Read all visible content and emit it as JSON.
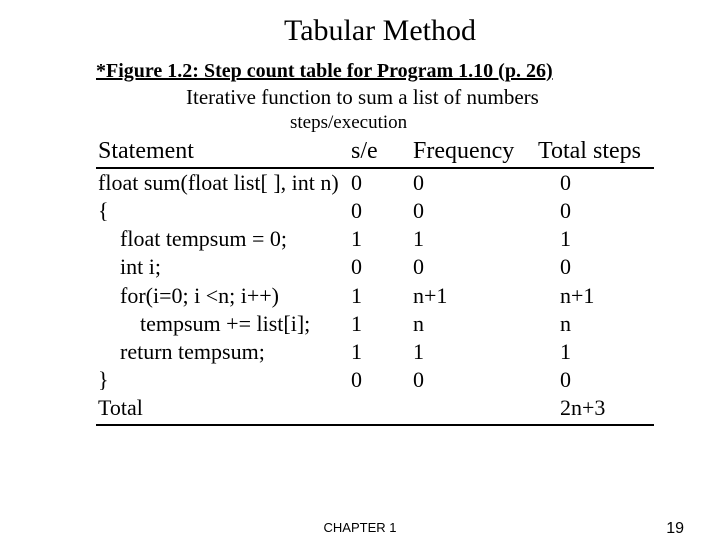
{
  "title": "Tabular Method",
  "figref": "*Figure 1.2: Step count table for Program 1.10 (p. 26)",
  "subtitle": "Iterative function to sum a list of numbers",
  "steps_execution": "steps/execution",
  "headers": {
    "statement": "Statement",
    "se": "s/e",
    "frequency": "Frequency",
    "total": "Total steps"
  },
  "rows": [
    {
      "stmt": "float sum(float list[ ], int n)",
      "indent": 0,
      "se": "0",
      "freq": "0",
      "tot": "0"
    },
    {
      "stmt": "{",
      "indent": 0,
      "se": "0",
      "freq": "0",
      "tot": "0"
    },
    {
      "stmt": "float tempsum = 0;",
      "indent": 1,
      "se": "1",
      "freq": "1",
      "tot": "1"
    },
    {
      "stmt": "int i;",
      "indent": 1,
      "se": "0",
      "freq": "0",
      "tot": "0"
    },
    {
      "stmt": "for(i=0; i <n; i++)",
      "indent": 1,
      "se": "1",
      "freq": "n+1",
      "tot": "n+1"
    },
    {
      "stmt": "tempsum += list[i];",
      "indent": 2,
      "se": "1",
      "freq": "n",
      "tot": "n"
    },
    {
      "stmt": "return tempsum;",
      "indent": 1,
      "se": "1",
      "freq": "1",
      "tot": "1"
    },
    {
      "stmt": "}",
      "indent": 0,
      "se": "0",
      "freq": "0",
      "tot": "0"
    },
    {
      "stmt": "Total",
      "indent": 0,
      "se": "",
      "freq": "",
      "tot": "2n+3"
    }
  ],
  "footer": {
    "chapter": "CHAPTER 1",
    "page": "19"
  },
  "chart_data": {
    "type": "table",
    "title": "Step count table for Program 1.10",
    "columns": [
      "Statement",
      "s/e",
      "Frequency",
      "Total steps"
    ],
    "rows": [
      [
        "float sum(float list[ ], int n)",
        "0",
        "0",
        "0"
      ],
      [
        "{",
        "0",
        "0",
        "0"
      ],
      [
        "float tempsum = 0;",
        "1",
        "1",
        "1"
      ],
      [
        "int i;",
        "0",
        "0",
        "0"
      ],
      [
        "for(i=0; i <n; i++)",
        "1",
        "n+1",
        "n+1"
      ],
      [
        "tempsum += list[i];",
        "1",
        "n",
        "n"
      ],
      [
        "return tempsum;",
        "1",
        "1",
        "1"
      ],
      [
        "}",
        "0",
        "0",
        "0"
      ],
      [
        "Total",
        "",
        "",
        "2n+3"
      ]
    ]
  }
}
